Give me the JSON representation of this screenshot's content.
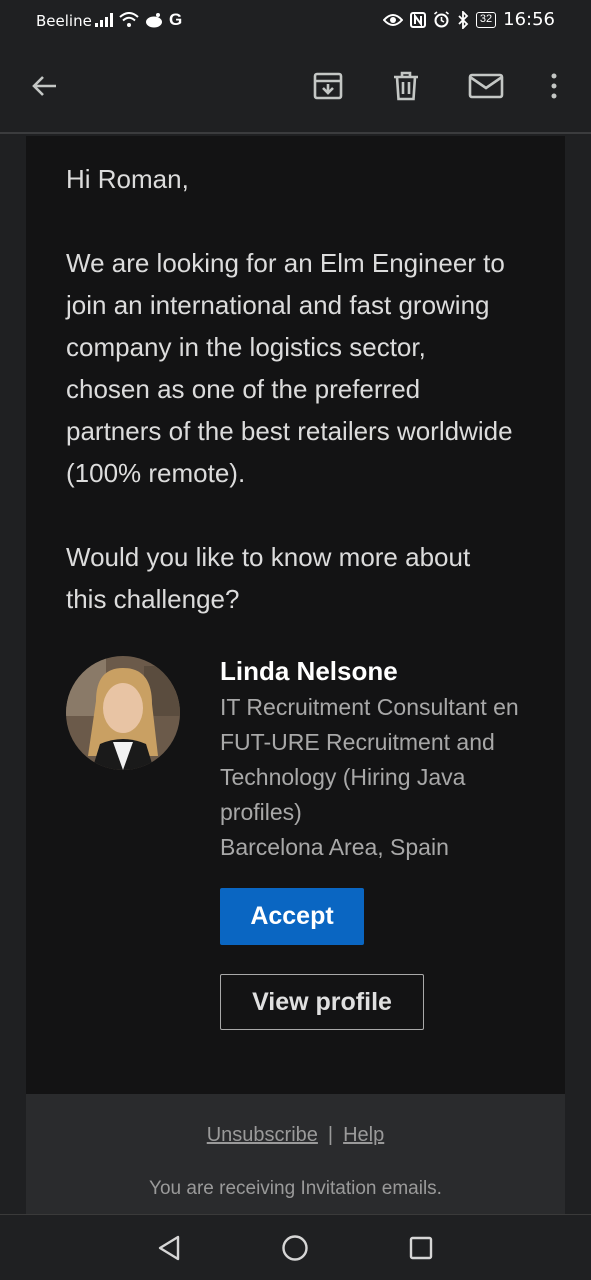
{
  "status_bar": {
    "carrier": "Beeline",
    "battery": "32",
    "time": "16:56"
  },
  "app_bar": {
    "icons": [
      "back-arrow-icon",
      "archive-icon",
      "delete-icon",
      "mark-unread-icon",
      "more-vert-icon"
    ]
  },
  "email": {
    "greeting": "Hi Roman,",
    "paragraph1": "We are looking for an Elm Engineer to join an international and fast growing company in the logistics sector, chosen as one of the preferred partners of the best retailers worldwide (100% remote).",
    "paragraph2": "Would you like to know more about this challenge?",
    "profile": {
      "name": "Linda Nelsone",
      "title": "IT Recruitment Consultant en FUT-URE Recruitment and Technology (Hiring Java profiles)",
      "location": "Barcelona Area, Spain"
    },
    "accept_label": "Accept",
    "view_profile_label": "View profile"
  },
  "footer": {
    "unsubscribe": "Unsubscribe",
    "separator": "|",
    "help": "Help",
    "note": "You are receiving Invitation emails."
  },
  "colors": {
    "accent": "#0a66c2",
    "card_bg": "#131314",
    "page_bg": "#1f2022"
  }
}
